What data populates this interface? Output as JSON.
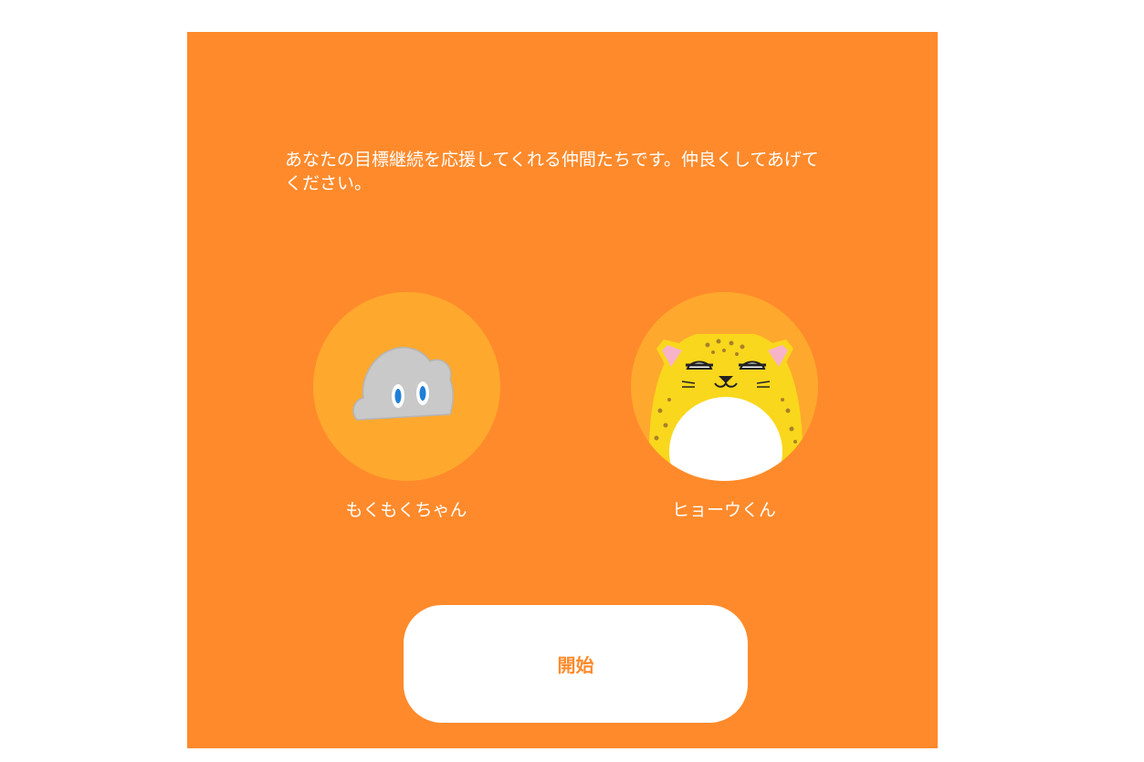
{
  "intro": {
    "line1": "あなたの目標継続を応援してくれる仲間たちです。仲良くしてあげて",
    "line2": "ください。"
  },
  "buddies": [
    {
      "name": "もくもくちゃん",
      "icon": "cloud-character-icon"
    },
    {
      "name": "ヒョーウくん",
      "icon": "leopard-character-icon"
    }
  ],
  "start": {
    "label": "開始"
  },
  "colors": {
    "panel": "#FF8A2B",
    "circle": "#FFA82E",
    "cloud": "#C9C9C9",
    "leopard": "#F9D71C",
    "button_text": "#FF8A2B"
  }
}
